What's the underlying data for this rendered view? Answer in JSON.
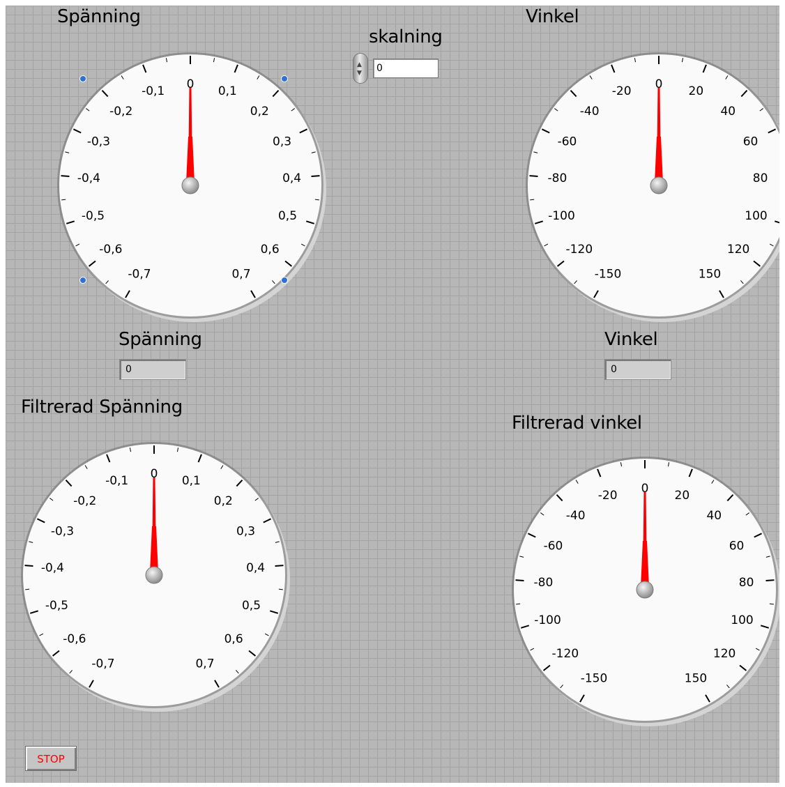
{
  "gauges": [
    {
      "id": "spanning",
      "label": "Spänning",
      "value": 0,
      "ticks": [
        "-0,7",
        "-0,6",
        "-0,5",
        "-0,4",
        "-0,3",
        "-0,2",
        "-0,1",
        "0",
        "0,1",
        "0,2",
        "0,3",
        "0,4",
        "0,5",
        "0,6",
        "0,7"
      ]
    },
    {
      "id": "vinkel",
      "label": "Vinkel",
      "value": 0,
      "ticks": [
        "-150",
        "-120",
        "-100",
        "-80",
        "-60",
        "-40",
        "-20",
        "0",
        "20",
        "40",
        "60",
        "80",
        "100",
        "120",
        "150"
      ]
    },
    {
      "id": "filtrerad-spanning",
      "label": "Filtrerad Spänning",
      "value": 0,
      "ticks": [
        "-0,7",
        "-0,6",
        "-0,5",
        "-0,4",
        "-0,3",
        "-0,2",
        "-0,1",
        "0",
        "0,1",
        "0,2",
        "0,3",
        "0,4",
        "0,5",
        "0,6",
        "0,7"
      ]
    },
    {
      "id": "filtrerad-vinkel",
      "label": "Filtrerad vinkel",
      "value": 0,
      "ticks": [
        "-150",
        "-120",
        "-100",
        "-80",
        "-60",
        "-40",
        "-20",
        "0",
        "20",
        "40",
        "60",
        "80",
        "100",
        "120",
        "150"
      ]
    }
  ],
  "skalning": {
    "label": "skalning",
    "value": "0"
  },
  "indicators": {
    "spanning": {
      "label": "Spänning",
      "value": "0"
    },
    "vinkel": {
      "label": "Vinkel",
      "value": "0"
    }
  },
  "stop_button": {
    "label": "STOP"
  },
  "colors": {
    "needle": "#ff0000",
    "panel": "#b7b7b7",
    "dial_face": "#fafafa",
    "stop_text": "#ff0000"
  }
}
